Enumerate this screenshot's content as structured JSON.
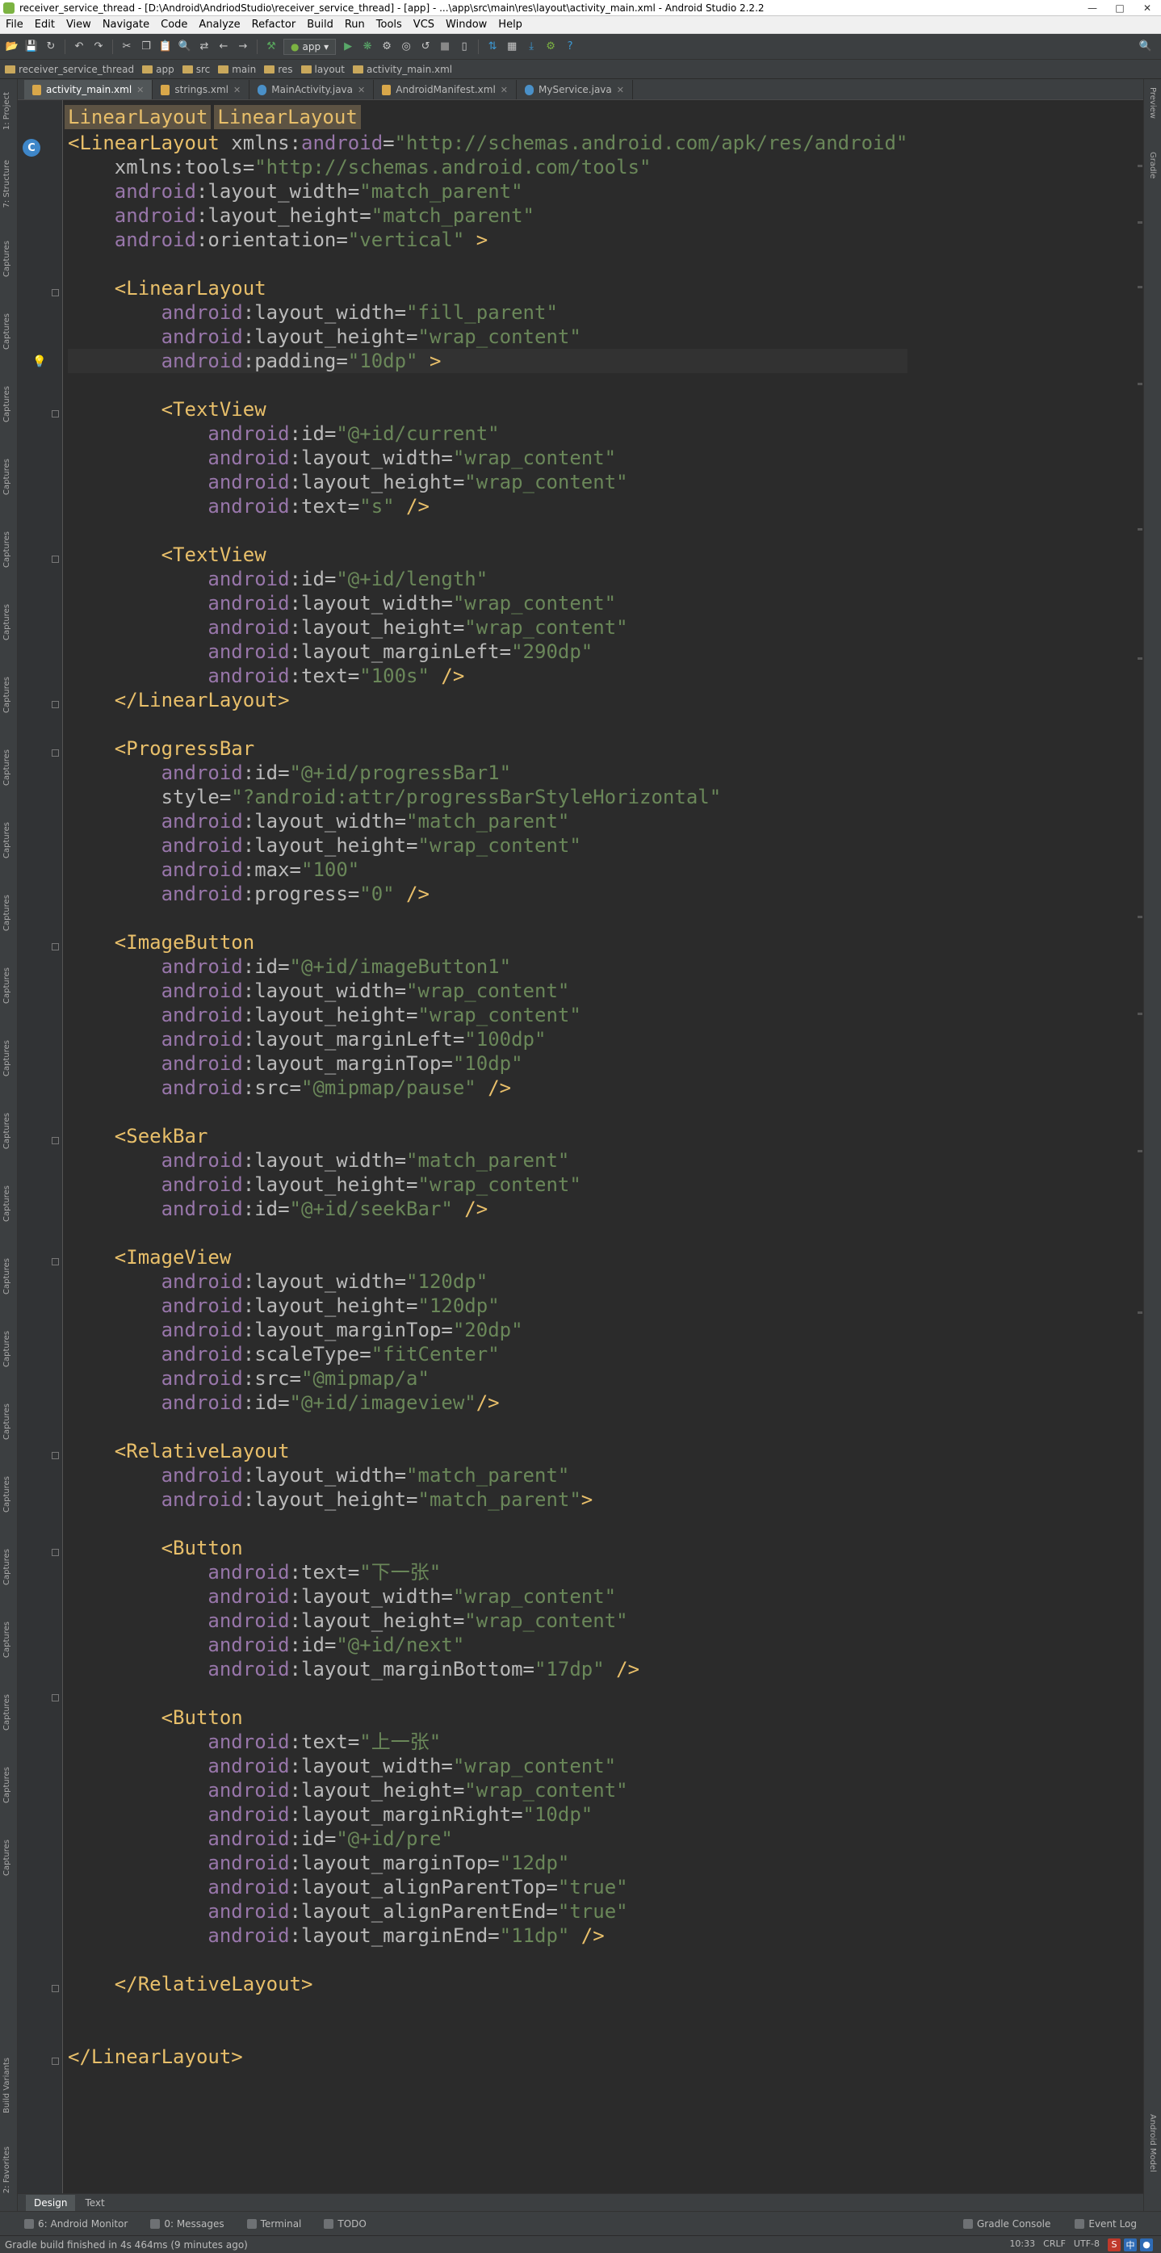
{
  "window": {
    "title": "receiver_service_thread - [D:\\Android\\AndriodStudio\\receiver_service_thread] - [app] - ...\\app\\src\\main\\res\\layout\\activity_main.xml - Android Studio 2.2.2"
  },
  "menu": [
    "File",
    "Edit",
    "View",
    "Navigate",
    "Code",
    "Analyze",
    "Refactor",
    "Build",
    "Run",
    "Tools",
    "VCS",
    "Window",
    "Help"
  ],
  "toolbar": {
    "run_config": "app"
  },
  "breadcrumbs": [
    "receiver_service_thread",
    "app",
    "src",
    "main",
    "res",
    "layout",
    "activity_main.xml"
  ],
  "tabs": [
    {
      "label": "activity_main.xml",
      "active": true,
      "type": "xml"
    },
    {
      "label": "strings.xml",
      "active": false,
      "type": "xml"
    },
    {
      "label": "MainActivity.java",
      "active": false,
      "type": "java"
    },
    {
      "label": "AndroidManifest.xml",
      "active": false,
      "type": "xml"
    },
    {
      "label": "MyService.java",
      "active": false,
      "type": "java"
    }
  ],
  "left_strip": [
    "1: Project",
    "7: Structure",
    "Captures",
    "Captures",
    "Captures",
    "Captures",
    "Captures",
    "Captures",
    "Captures",
    "Captures",
    "Captures",
    "Captures",
    "Captures",
    "Captures",
    "Captures",
    "Captures",
    "Captures",
    "Captures",
    "Captures",
    "Captures",
    "Captures",
    "Captures",
    "Captures",
    "Captures",
    "Captures",
    "Build Variants",
    "2: Favorites"
  ],
  "right_strip": [
    "Preview",
    "Gradle",
    "Android Model"
  ],
  "editor": {
    "tag_breadcrumbs": [
      "LinearLayout",
      "LinearLayout"
    ],
    "gutter_badge": "C",
    "lines": [
      [
        [
          "tag",
          "<LinearLayout "
        ],
        [
          "attr",
          "xmlns:"
        ],
        [
          "ns",
          "android"
        ],
        [
          "attr",
          "="
        ],
        [
          "val",
          "\"http://schemas.android.com/apk/res/android\""
        ]
      ],
      [
        [
          "attr",
          "    xmlns:tools="
        ],
        [
          "val",
          "\"http://schemas.android.com/tools\""
        ]
      ],
      [
        [
          "ns",
          "    android"
        ],
        [
          "attr",
          ":layout_width="
        ],
        [
          "val",
          "\"match_parent\""
        ]
      ],
      [
        [
          "ns",
          "    android"
        ],
        [
          "attr",
          ":layout_height="
        ],
        [
          "val",
          "\"match_parent\""
        ]
      ],
      [
        [
          "ns",
          "    android"
        ],
        [
          "attr",
          ":orientation="
        ],
        [
          "val",
          "\"vertical\""
        ],
        [
          "tag",
          " >"
        ]
      ],
      [],
      [
        [
          "tag",
          "    <LinearLayout"
        ]
      ],
      [
        [
          "ns",
          "        android"
        ],
        [
          "attr",
          ":layout_width="
        ],
        [
          "val",
          "\"fill_parent\""
        ]
      ],
      [
        [
          "ns",
          "        android"
        ],
        [
          "attr",
          ":layout_height="
        ],
        [
          "val",
          "\"wrap_content\""
        ]
      ],
      [
        [
          "ns",
          "        android"
        ],
        [
          "attr",
          ":padding="
        ],
        [
          "val",
          "\"10dp\""
        ],
        [
          "tag",
          " >"
        ]
      ],
      [],
      [
        [
          "tag",
          "        <TextView"
        ]
      ],
      [
        [
          "ns",
          "            android"
        ],
        [
          "attr",
          ":id="
        ],
        [
          "val",
          "\"@+id/current\""
        ]
      ],
      [
        [
          "ns",
          "            android"
        ],
        [
          "attr",
          ":layout_width="
        ],
        [
          "val",
          "\"wrap_content\""
        ]
      ],
      [
        [
          "ns",
          "            android"
        ],
        [
          "attr",
          ":layout_height="
        ],
        [
          "val",
          "\"wrap_content\""
        ]
      ],
      [
        [
          "ns",
          "            android"
        ],
        [
          "attr",
          ":text="
        ],
        [
          "val",
          "\"s\""
        ],
        [
          "tag",
          " />"
        ]
      ],
      [],
      [
        [
          "tag",
          "        <TextView"
        ]
      ],
      [
        [
          "ns",
          "            android"
        ],
        [
          "attr",
          ":id="
        ],
        [
          "val",
          "\"@+id/length\""
        ]
      ],
      [
        [
          "ns",
          "            android"
        ],
        [
          "attr",
          ":layout_width="
        ],
        [
          "val",
          "\"wrap_content\""
        ]
      ],
      [
        [
          "ns",
          "            android"
        ],
        [
          "attr",
          ":layout_height="
        ],
        [
          "val",
          "\"wrap_content\""
        ]
      ],
      [
        [
          "ns",
          "            android"
        ],
        [
          "attr",
          ":layout_marginLeft="
        ],
        [
          "val",
          "\"290dp\""
        ]
      ],
      [
        [
          "ns",
          "            android"
        ],
        [
          "attr",
          ":text="
        ],
        [
          "val",
          "\"100s\""
        ],
        [
          "tag",
          " />"
        ]
      ],
      [
        [
          "tag",
          "    </LinearLayout>"
        ]
      ],
      [],
      [
        [
          "tag",
          "    <ProgressBar"
        ]
      ],
      [
        [
          "ns",
          "        android"
        ],
        [
          "attr",
          ":id="
        ],
        [
          "val",
          "\"@+id/progressBar1\""
        ]
      ],
      [
        [
          "attr",
          "        style="
        ],
        [
          "val",
          "\"?android:attr/progressBarStyleHorizontal\""
        ]
      ],
      [
        [
          "ns",
          "        android"
        ],
        [
          "attr",
          ":layout_width="
        ],
        [
          "val",
          "\"match_parent\""
        ]
      ],
      [
        [
          "ns",
          "        android"
        ],
        [
          "attr",
          ":layout_height="
        ],
        [
          "val",
          "\"wrap_content\""
        ]
      ],
      [
        [
          "ns",
          "        android"
        ],
        [
          "attr",
          ":max="
        ],
        [
          "val",
          "\"100\""
        ]
      ],
      [
        [
          "ns",
          "        android"
        ],
        [
          "attr",
          ":progress="
        ],
        [
          "val",
          "\"0\""
        ],
        [
          "tag",
          " />"
        ]
      ],
      [],
      [
        [
          "tag",
          "    <ImageButton"
        ]
      ],
      [
        [
          "ns",
          "        android"
        ],
        [
          "attr",
          ":id="
        ],
        [
          "val",
          "\"@+id/imageButton1\""
        ]
      ],
      [
        [
          "ns",
          "        android"
        ],
        [
          "attr",
          ":layout_width="
        ],
        [
          "val",
          "\"wrap_content\""
        ]
      ],
      [
        [
          "ns",
          "        android"
        ],
        [
          "attr",
          ":layout_height="
        ],
        [
          "val",
          "\"wrap_content\""
        ]
      ],
      [
        [
          "ns",
          "        android"
        ],
        [
          "attr",
          ":layout_marginLeft="
        ],
        [
          "val",
          "\"100dp\""
        ]
      ],
      [
        [
          "ns",
          "        android"
        ],
        [
          "attr",
          ":layout_marginTop="
        ],
        [
          "val",
          "\"10dp\""
        ]
      ],
      [
        [
          "ns",
          "        android"
        ],
        [
          "attr",
          ":src="
        ],
        [
          "val",
          "\"@mipmap/pause\""
        ],
        [
          "tag",
          " />"
        ]
      ],
      [],
      [
        [
          "tag",
          "    <SeekBar"
        ]
      ],
      [
        [
          "ns",
          "        android"
        ],
        [
          "attr",
          ":layout_width="
        ],
        [
          "val",
          "\"match_parent\""
        ]
      ],
      [
        [
          "ns",
          "        android"
        ],
        [
          "attr",
          ":layout_height="
        ],
        [
          "val",
          "\"wrap_content\""
        ]
      ],
      [
        [
          "ns",
          "        android"
        ],
        [
          "attr",
          ":id="
        ],
        [
          "val",
          "\"@+id/seekBar\""
        ],
        [
          "tag",
          " />"
        ]
      ],
      [],
      [
        [
          "tag",
          "    <ImageView"
        ]
      ],
      [
        [
          "ns",
          "        android"
        ],
        [
          "attr",
          ":layout_width="
        ],
        [
          "val",
          "\"120dp\""
        ]
      ],
      [
        [
          "ns",
          "        android"
        ],
        [
          "attr",
          ":layout_height="
        ],
        [
          "val",
          "\"120dp\""
        ]
      ],
      [
        [
          "ns",
          "        android"
        ],
        [
          "attr",
          ":layout_marginTop="
        ],
        [
          "val",
          "\"20dp\""
        ]
      ],
      [
        [
          "ns",
          "        android"
        ],
        [
          "attr",
          ":scaleType="
        ],
        [
          "val",
          "\"fitCenter\""
        ]
      ],
      [
        [
          "ns",
          "        android"
        ],
        [
          "attr",
          ":src="
        ],
        [
          "val",
          "\"@mipmap/a\""
        ]
      ],
      [
        [
          "ns",
          "        android"
        ],
        [
          "attr",
          ":id="
        ],
        [
          "val",
          "\"@+id/imageview\""
        ],
        [
          "tag",
          "/>"
        ]
      ],
      [],
      [
        [
          "tag",
          "    <RelativeLayout"
        ]
      ],
      [
        [
          "ns",
          "        android"
        ],
        [
          "attr",
          ":layout_width="
        ],
        [
          "val",
          "\"match_parent\""
        ]
      ],
      [
        [
          "ns",
          "        android"
        ],
        [
          "attr",
          ":layout_height="
        ],
        [
          "val",
          "\"match_parent\""
        ],
        [
          "tag",
          ">"
        ]
      ],
      [],
      [
        [
          "tag",
          "        <Button"
        ]
      ],
      [
        [
          "ns",
          "            android"
        ],
        [
          "attr",
          ":text="
        ],
        [
          "val",
          "\"下一张\""
        ]
      ],
      [
        [
          "ns",
          "            android"
        ],
        [
          "attr",
          ":layout_width="
        ],
        [
          "val",
          "\"wrap_content\""
        ]
      ],
      [
        [
          "ns",
          "            android"
        ],
        [
          "attr",
          ":layout_height="
        ],
        [
          "val",
          "\"wrap_content\""
        ]
      ],
      [
        [
          "ns",
          "            android"
        ],
        [
          "attr",
          ":id="
        ],
        [
          "val",
          "\"@+id/next\""
        ]
      ],
      [
        [
          "ns",
          "            android"
        ],
        [
          "attr",
          ":layout_marginBottom="
        ],
        [
          "val",
          "\"17dp\""
        ],
        [
          "tag",
          " />"
        ]
      ],
      [],
      [
        [
          "tag",
          "        <Button"
        ]
      ],
      [
        [
          "ns",
          "            android"
        ],
        [
          "attr",
          ":text="
        ],
        [
          "val",
          "\"上一张\""
        ]
      ],
      [
        [
          "ns",
          "            android"
        ],
        [
          "attr",
          ":layout_width="
        ],
        [
          "val",
          "\"wrap_content\""
        ]
      ],
      [
        [
          "ns",
          "            android"
        ],
        [
          "attr",
          ":layout_height="
        ],
        [
          "val",
          "\"wrap_content\""
        ]
      ],
      [
        [
          "ns",
          "            android"
        ],
        [
          "attr",
          ":layout_marginRight="
        ],
        [
          "val",
          "\"10dp\""
        ]
      ],
      [
        [
          "ns",
          "            android"
        ],
        [
          "attr",
          ":id="
        ],
        [
          "val",
          "\"@+id/pre\""
        ]
      ],
      [
        [
          "ns",
          "            android"
        ],
        [
          "attr",
          ":layout_marginTop="
        ],
        [
          "val",
          "\"12dp\""
        ]
      ],
      [
        [
          "ns",
          "            android"
        ],
        [
          "attr",
          ":layout_alignParentTop="
        ],
        [
          "val",
          "\"true\""
        ]
      ],
      [
        [
          "ns",
          "            android"
        ],
        [
          "attr",
          ":layout_alignParentEnd="
        ],
        [
          "val",
          "\"true\""
        ]
      ],
      [
        [
          "ns",
          "            android"
        ],
        [
          "attr",
          ":layout_marginEnd="
        ],
        [
          "val",
          "\"11dp\""
        ],
        [
          "tag",
          " />"
        ]
      ],
      [],
      [
        [
          "tag",
          "    </RelativeLayout>"
        ]
      ],
      [],
      [],
      [
        [
          "tag",
          "</LinearLayout>"
        ]
      ]
    ]
  },
  "design_tabs": [
    {
      "label": "Design",
      "active": true
    },
    {
      "label": "Text",
      "active": false
    }
  ],
  "tool_windows": [
    "6: Android Monitor",
    "0: Messages",
    "Terminal",
    "TODO"
  ],
  "tool_windows_right": [
    "Gradle Console",
    "Event Log"
  ],
  "status": {
    "message": "Gradle build finished in 4s 464ms (9 minutes ago)",
    "position": "10:33",
    "line_sep": "CRLF",
    "encoding": "UTF-8"
  }
}
